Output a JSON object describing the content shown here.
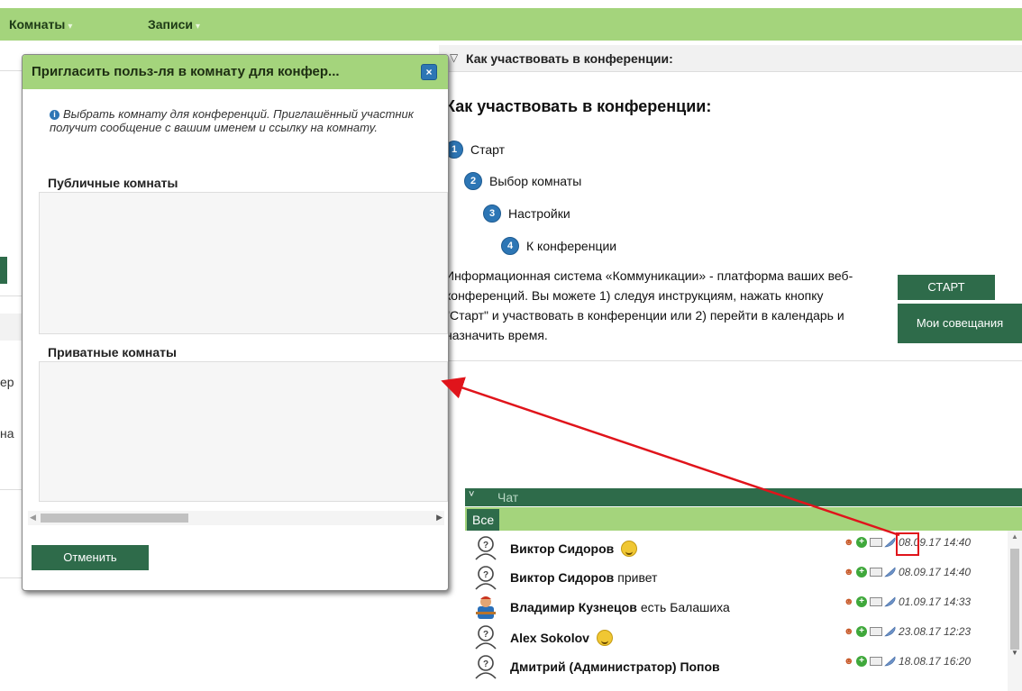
{
  "top_menu": {
    "rooms": "Комнаты",
    "records": "Записи"
  },
  "left_fragments": {
    "frag1": "ер",
    "frag2": "на"
  },
  "info": {
    "header": "Как участвовать в конференции:",
    "title": "Как участвовать в конференции:",
    "steps": [
      {
        "n": "1",
        "label": "Старт"
      },
      {
        "n": "2",
        "label": "Выбор комнаты"
      },
      {
        "n": "3",
        "label": "Настройки"
      },
      {
        "n": "4",
        "label": "К конференции"
      }
    ],
    "description": "Информационная система «Коммуникации» - платформа ваших веб-конференций. Вы можете 1) следуя инструкциям, нажать кнопку \"Старт\" и участвовать в конференции или 2) перейти в календарь и назначить время.",
    "start_button": "СТАРТ",
    "meetings_button": "Мои совещания"
  },
  "dialog": {
    "title": "Пригласить польз-ля в комнату для конфер...",
    "close": "×",
    "hint": "Выбрать комнату для конференций. Приглашённый участник получит сообщение с вашим именем и ссылку на комнату.",
    "public_label": "Публичные комнаты",
    "private_label": "Приватные комнаты",
    "cancel": "Отменить"
  },
  "chat": {
    "title": "Чат",
    "tab_all": "Все",
    "messages": [
      {
        "name": "Виктор Сидоров",
        "text": "",
        "smile": true,
        "date": "08.09.17 14:40",
        "avatar": "unknown-user-icon"
      },
      {
        "name": "Виктор Сидоров",
        "text": "привет",
        "smile": false,
        "date": "08.09.17 14:40",
        "avatar": "unknown-user-icon"
      },
      {
        "name": "Владимир Кузнецов",
        "text": "есть Балашиха",
        "smile": false,
        "date": "01.09.17 14:33",
        "avatar": "user-photo-avatar"
      },
      {
        "name": "Alex Sokolov",
        "text": "",
        "smile": true,
        "date": "23.08.17 12:23",
        "avatar": "unknown-user-icon"
      },
      {
        "name": "Дмитрий (Администратор) Попов",
        "text": "",
        "smile": false,
        "date": "18.08.17 16:20",
        "avatar": "unknown-user-icon"
      }
    ]
  },
  "colors": {
    "accent_green": "#a4d47c",
    "dark_green": "#2e6b4a",
    "annotation_red": "#e0141b",
    "step_blue": "#2d76b5"
  }
}
